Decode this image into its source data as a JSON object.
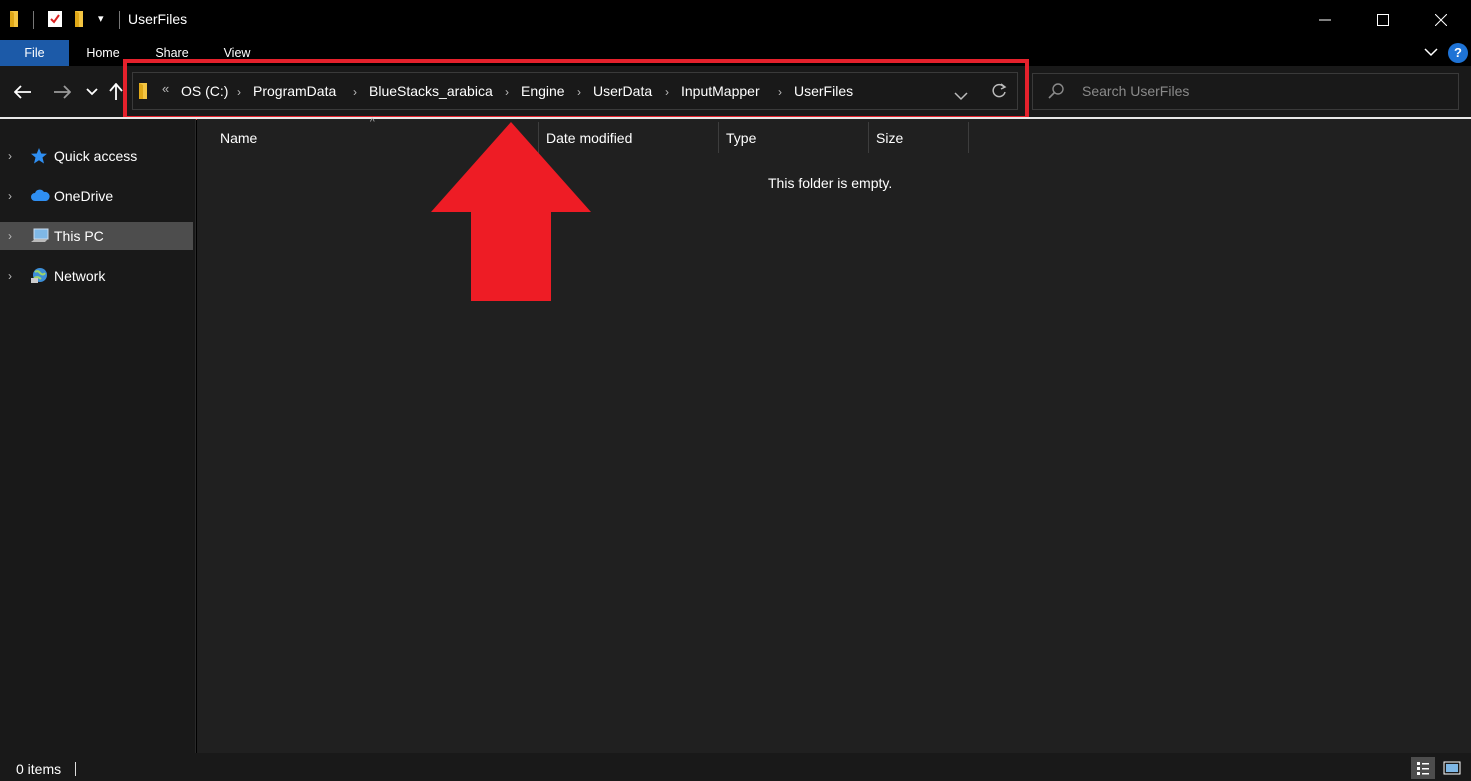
{
  "window": {
    "title": "UserFiles",
    "quick_access_dropdown": "▾"
  },
  "ribbon": {
    "tabs": [
      {
        "label": "File"
      },
      {
        "label": "Home"
      },
      {
        "label": "Share"
      },
      {
        "label": "View"
      }
    ],
    "help": "?"
  },
  "address": {
    "overflow": "«",
    "crumbs": [
      "OS (C:)",
      "ProgramData",
      "BlueStacks_arabica",
      "Engine",
      "UserData",
      "InputMapper",
      "UserFiles"
    ]
  },
  "search": {
    "placeholder": "Search UserFiles"
  },
  "navpane": {
    "items": [
      {
        "label": "Quick access",
        "icon": "star-icon"
      },
      {
        "label": "OneDrive",
        "icon": "cloud-icon"
      },
      {
        "label": "This PC",
        "icon": "computer-icon",
        "selected": true
      },
      {
        "label": "Network",
        "icon": "network-icon"
      }
    ]
  },
  "columns": {
    "name": "Name",
    "date_modified": "Date modified",
    "type": "Type",
    "size": "Size"
  },
  "content": {
    "empty_message": "This folder is empty."
  },
  "status": {
    "item_count": "0 items"
  },
  "colors": {
    "highlight": "#e5212c",
    "file_tab": "#1c5aa8",
    "help": "#1e73d6"
  }
}
